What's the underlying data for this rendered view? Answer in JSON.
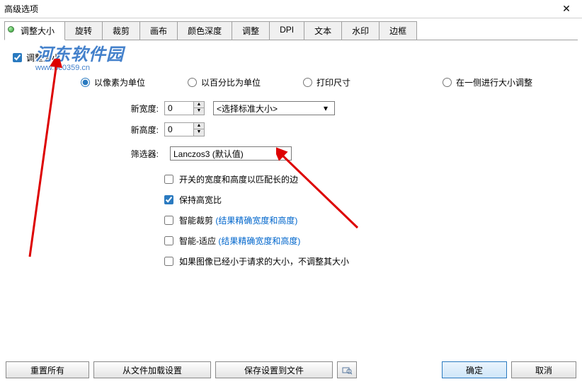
{
  "titlebar": {
    "title": "高级选项"
  },
  "tabs": [
    {
      "label": "调整大小",
      "active": true
    },
    {
      "label": "旋转"
    },
    {
      "label": "裁剪"
    },
    {
      "label": "画布"
    },
    {
      "label": "颜色深度"
    },
    {
      "label": "调整"
    },
    {
      "label": "DPI"
    },
    {
      "label": "文本"
    },
    {
      "label": "水印"
    },
    {
      "label": "边框"
    }
  ],
  "watermark": {
    "top": "河东软件园",
    "bottom": "www.pc0359.cn"
  },
  "resize": {
    "enable_label": "调整大小",
    "enable_checked": true,
    "unit": {
      "pixel": "以像素为单位",
      "percent": "以百分比为单位",
      "print": "打印尺寸",
      "oneside": "在一侧进行大小调整",
      "selected": "pixel"
    },
    "width_label": "新宽度:",
    "width_value": "0",
    "height_label": "新高度:",
    "height_value": "0",
    "standard_label": "<选择标准大小>",
    "filter_label": "筛选器:",
    "filter_value": "Lanczos3 (默认值)",
    "opts": {
      "swap": {
        "label": "开关的宽度和高度以匹配长的边",
        "checked": false
      },
      "keep_ratio": {
        "label": "保持高宽比",
        "checked": true
      },
      "smart_crop": {
        "label": "智能裁剪",
        "paren": "(结果精确宽度和高度)",
        "checked": false
      },
      "smart_fit": {
        "label": "智能-适应",
        "paren": "(结果精确宽度和高度)",
        "checked": false
      },
      "skip_smaller": {
        "label": "如果图像已经小于请求的大小，不调整其大小",
        "checked": false
      }
    }
  },
  "footer": {
    "reset": "重置所有",
    "load": "从文件加载设置",
    "save": "保存设置到文件",
    "ok": "确定",
    "cancel": "取消"
  }
}
